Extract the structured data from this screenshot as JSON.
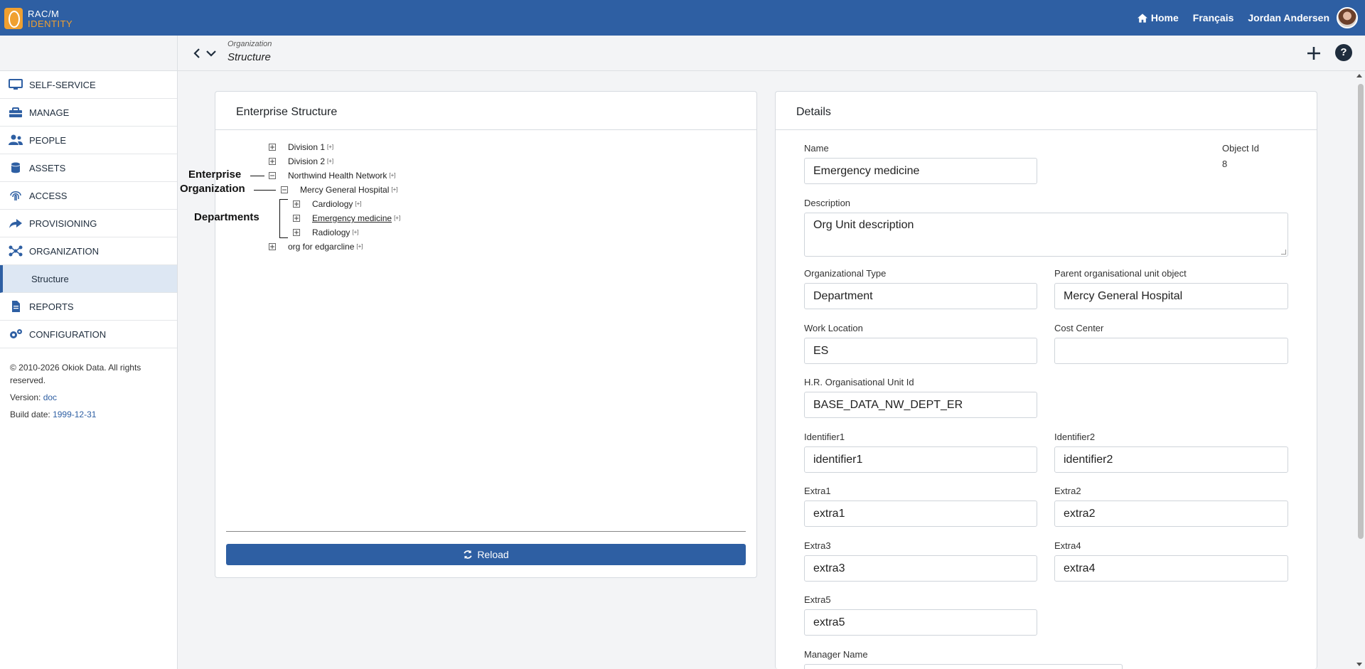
{
  "app": {
    "logo_line1": "RAC/M",
    "logo_line2": "IDENTITY"
  },
  "topnav": {
    "home": "Home",
    "language": "Français",
    "user": "Jordan Andersen"
  },
  "sidebar": {
    "items": [
      {
        "label": "SELF-SERVICE",
        "icon": "monitor-icon"
      },
      {
        "label": "MANAGE",
        "icon": "toolbox-icon"
      },
      {
        "label": "PEOPLE",
        "icon": "users-icon"
      },
      {
        "label": "ASSETS",
        "icon": "database-icon"
      },
      {
        "label": "ACCESS",
        "icon": "fingerprint-icon"
      },
      {
        "label": "PROVISIONING",
        "icon": "share-icon"
      },
      {
        "label": "ORGANIZATION",
        "icon": "network-icon"
      }
    ],
    "active_sub": "Structure",
    "items_after": [
      {
        "label": "REPORTS",
        "icon": "file-icon"
      },
      {
        "label": "CONFIGURATION",
        "icon": "cogs-icon"
      }
    ],
    "footer": {
      "copyright": "© 2010-2026 Okiok Data. All rights reserved.",
      "version_label": "Version:",
      "version_link": "doc",
      "build_label": "Build date:",
      "build_value": "1999-12-31"
    }
  },
  "breadcrumb": {
    "parent": "Organization",
    "current": "Structure"
  },
  "structure_panel": {
    "title": "Enterprise Structure",
    "plus_marker": "[+]",
    "nodes": {
      "division1": "Division 1",
      "division2": "Division 2",
      "network": "Northwind Health Network",
      "hospital": "Mercy General Hospital",
      "cardiology": "Cardiology",
      "emergency": "Emergency medicine",
      "radiology": "Radiology",
      "org_edg": "org for edgarcline"
    },
    "annotations": {
      "enterprise": "Enterprise",
      "organization": "Organization",
      "departments": "Departments"
    },
    "reload_label": "Reload"
  },
  "details_panel": {
    "title": "Details",
    "fields": {
      "name_label": "Name",
      "name_value": "Emergency medicine",
      "object_id_label": "Object Id",
      "object_id_value": "8",
      "description_label": "Description",
      "description_value": "Org Unit description",
      "org_type_label": "Organizational Type",
      "org_type_value": "Department",
      "parent_label": "Parent organisational unit object",
      "parent_value": "Mercy General Hospital",
      "work_location_label": "Work Location",
      "work_location_value": "ES",
      "cost_center_label": "Cost Center",
      "cost_center_value": "",
      "hr_label": "H.R. Organisational Unit Id",
      "hr_value": "BASE_DATA_NW_DEPT_ER",
      "identifier1_label": "Identifier1",
      "identifier1_value": "identifier1",
      "identifier2_label": "Identifier2",
      "identifier2_value": "identifier2",
      "extra1_label": "Extra1",
      "extra1_value": "extra1",
      "extra2_label": "Extra2",
      "extra2_value": "extra2",
      "extra3_label": "Extra3",
      "extra3_value": "extra3",
      "extra4_label": "Extra4",
      "extra4_value": "extra4",
      "extra5_label": "Extra5",
      "extra5_value": "extra5",
      "manager_label": "Manager Name"
    }
  },
  "colors": {
    "brand": "#2e5fa3",
    "accent": "#f0a030"
  }
}
